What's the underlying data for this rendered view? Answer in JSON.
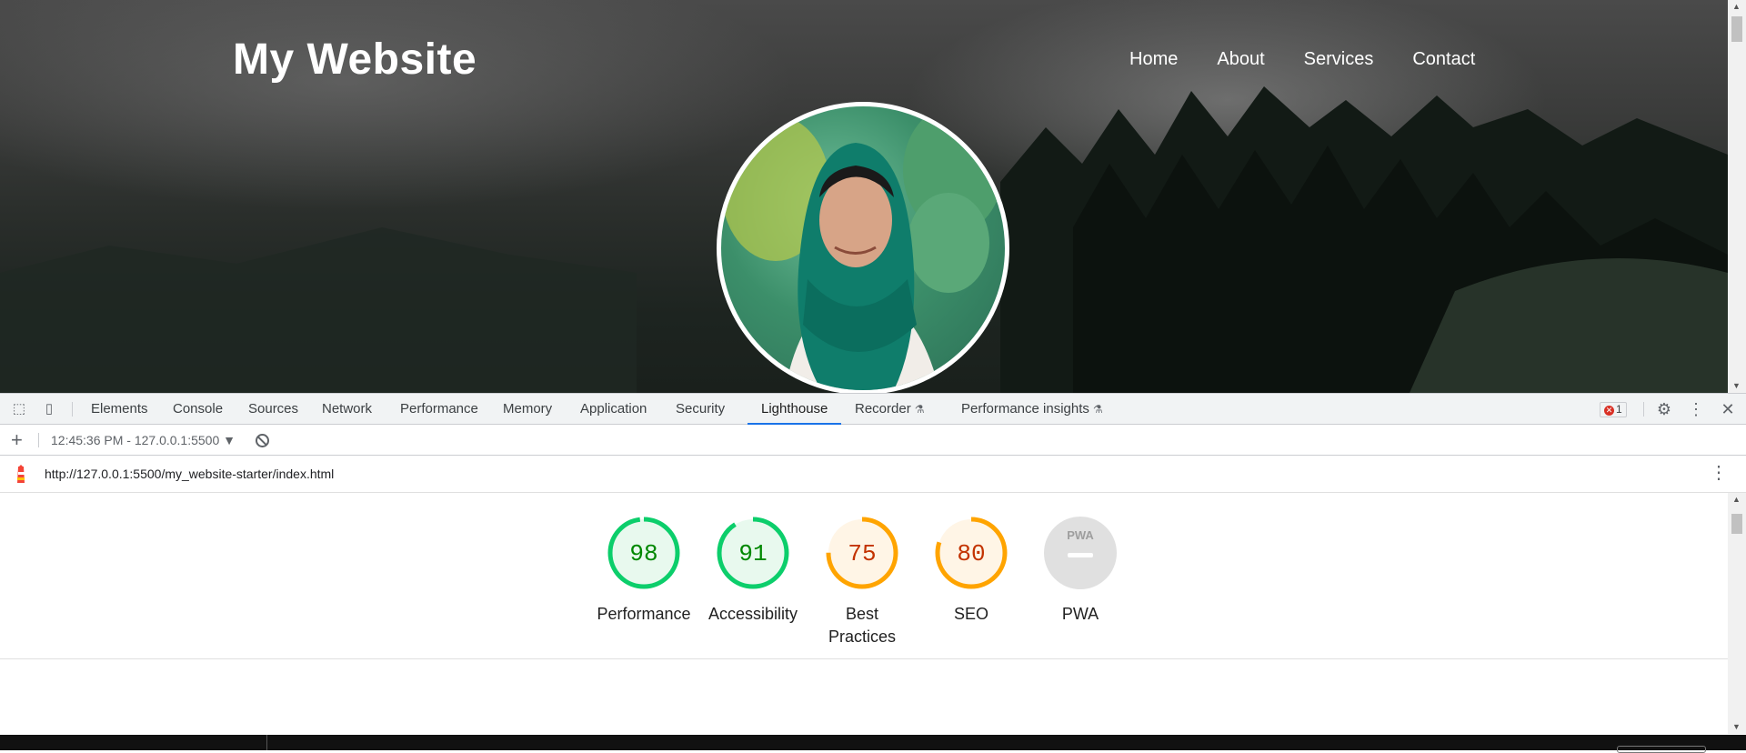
{
  "site": {
    "logo": "My Website",
    "nav": [
      "Home",
      "About",
      "Services",
      "Contact"
    ]
  },
  "devtools": {
    "tabs": [
      "Elements",
      "Console",
      "Sources",
      "Network",
      "Performance",
      "Memory",
      "Application",
      "Security",
      "Lighthouse",
      "Recorder",
      "Performance insights"
    ],
    "active_tab": "Lighthouse",
    "error_count": "1",
    "report_selector": "12:45:36 PM - 127.0.0.1:5500",
    "url": "http://127.0.0.1:5500/my_website-starter/index.html"
  },
  "lighthouse": {
    "gauges": [
      {
        "label": "Performance",
        "score": "98",
        "percent": 98,
        "color": "#0cce6b",
        "fill": "#e8f9ee",
        "text_color": "#008800"
      },
      {
        "label": "Accessibility",
        "score": "91",
        "percent": 91,
        "color": "#0cce6b",
        "fill": "#e8f9ee",
        "text_color": "#008800"
      },
      {
        "label": "Best Practices",
        "score": "75",
        "percent": 75,
        "color": "#ffa400",
        "fill": "#fff5e6",
        "text_color": "#c33300"
      },
      {
        "label": "SEO",
        "score": "80",
        "percent": 80,
        "color": "#ffa400",
        "fill": "#fff5e6",
        "text_color": "#c33300"
      },
      {
        "label": "PWA",
        "score": "",
        "percent": 0,
        "color": "#cccccc",
        "fill": "#e0e0e0",
        "text_color": "#9e9e9e"
      }
    ],
    "pwa_badge_text": "PWA"
  }
}
